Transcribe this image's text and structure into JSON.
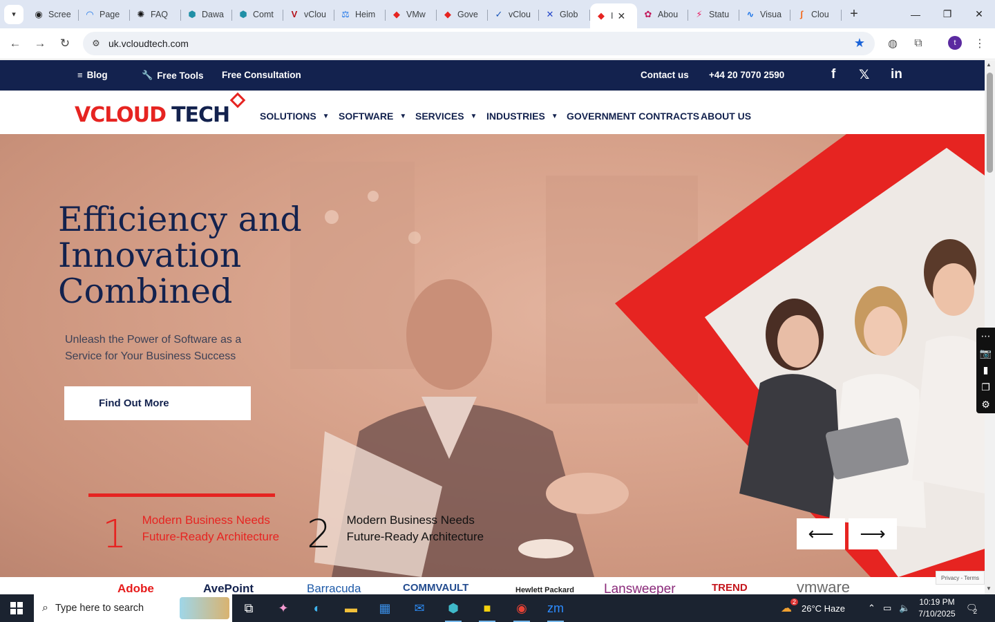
{
  "browser": {
    "tabs": [
      {
        "label": "Scree",
        "icon": "screen-icon",
        "color": "#222222"
      },
      {
        "label": "Page",
        "icon": "gauge-icon",
        "color": "#1a73e8"
      },
      {
        "label": "FAQ",
        "icon": "openai-icon",
        "color": "#111111"
      },
      {
        "label": "Dawa",
        "icon": "hexagon-icon",
        "color": "#1f8fa6"
      },
      {
        "label": "Comt",
        "icon": "hexagon-icon",
        "color": "#1f8fa6"
      },
      {
        "label": "vClou",
        "icon": "v-icon",
        "color": "#b5121b"
      },
      {
        "label": "Heim",
        "icon": "scales-icon",
        "color": "#1a73e8"
      },
      {
        "label": "VMw",
        "icon": "vcloud-icon",
        "color": "#e62421"
      },
      {
        "label": "Gove",
        "icon": "vcloud-icon",
        "color": "#e62421"
      },
      {
        "label": "vClou",
        "icon": "check-icon",
        "color": "#1a56b8"
      },
      {
        "label": "Glob",
        "icon": "x-icon",
        "color": "#2245c9"
      }
    ],
    "active_tab": {
      "label": "I",
      "icon": "vcloud-icon",
      "color": "#e62421"
    },
    "tabs_after": [
      {
        "label": "Abou",
        "icon": "flower-icon",
        "color": "#c2185b"
      },
      {
        "label": "Statu",
        "icon": "bolt-icon",
        "color": "#e91e63"
      },
      {
        "label": "Visua",
        "icon": "pulse-icon",
        "color": "#1a73e8"
      },
      {
        "label": "Clou",
        "icon": "swoosh-icon",
        "color": "#f26b21"
      }
    ],
    "url": "uk.vcloudtech.com",
    "profile_initial": "t"
  },
  "topbar": {
    "blog": "Blog",
    "free_tools": "Free Tools",
    "free_consultation": "Free Consultation",
    "contact": "Contact us",
    "phone": "+44 20 7070 2590",
    "social": [
      "f",
      "𝕏",
      "in"
    ]
  },
  "logo": {
    "part1": "V",
    "part2": "CLOUD",
    "part3": "TECH"
  },
  "menu": [
    {
      "label": "SOLUTIONS",
      "dropdown": true
    },
    {
      "label": "SOFTWARE",
      "dropdown": true
    },
    {
      "label": "SERVICES",
      "dropdown": true
    },
    {
      "label": "INDUSTRIES",
      "dropdown": true
    },
    {
      "label": "GOVERNMENT CONTRACTS",
      "dropdown": false
    },
    {
      "label": "ABOUT US",
      "dropdown": false
    }
  ],
  "hero": {
    "title": "Efficiency and Innovation Combined",
    "subtitle": "Unleash the Power of Software as a Service for Your Business Success",
    "cta": "Find Out More",
    "steps": [
      {
        "num": "1",
        "text": "Modern Business Needs Future-Ready Architecture"
      },
      {
        "num": "2",
        "text": "Modern Business Needs Future-Ready Architecture"
      }
    ],
    "prev_arrow": "⟵",
    "next_arrow": "⟶"
  },
  "brands": [
    "Adobe",
    "AvePoint",
    "Barracuda",
    "COMMVAULT",
    "Hewlett Packard",
    "Lansweeper",
    "TREND",
    "vmware"
  ],
  "recaptcha": "Privacy - Terms",
  "taskbar": {
    "search_placeholder": "Type here to search",
    "weather": "26°C  Haze",
    "weather_badge": "2",
    "time": "10:19 PM",
    "date": "7/10/2025",
    "notifications": "2"
  },
  "colors": {
    "navy": "#13224e",
    "brand_red": "#e62421"
  }
}
